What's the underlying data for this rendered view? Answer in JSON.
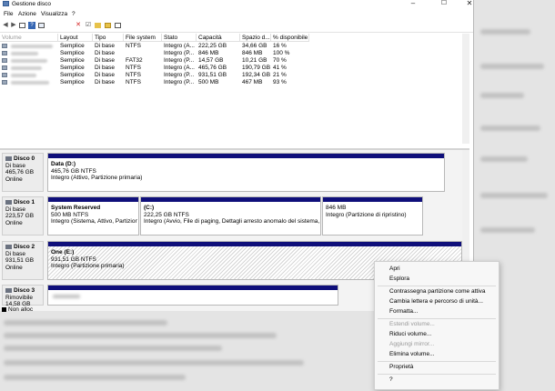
{
  "window": {
    "title": "Gestione disco"
  },
  "menu": [
    "File",
    "Azione",
    "Visualizza",
    "?"
  ],
  "volume_table": {
    "headers": [
      "Volume",
      "Layout",
      "Tipo",
      "File system",
      "Stato",
      "Capacità",
      "Spazio d...",
      "% disponibile"
    ],
    "rows": [
      [
        "Semplice",
        "Di base",
        "NTFS",
        "Integro (A...",
        "222,25 GB",
        "34,66 GB",
        "16 %"
      ],
      [
        "Semplice",
        "Di base",
        "",
        "Integro (P...",
        "846 MB",
        "846 MB",
        "100 %"
      ],
      [
        "Semplice",
        "Di base",
        "FAT32",
        "Integro (P...",
        "14,57 GB",
        "10,21 GB",
        "70 %"
      ],
      [
        "Semplice",
        "Di base",
        "NTFS",
        "Integro (A...",
        "465,76 GB",
        "190,79 GB",
        "41 %"
      ],
      [
        "Semplice",
        "Di base",
        "NTFS",
        "Integro (P...",
        "931,51 GB",
        "192,34 GB",
        "21 %"
      ],
      [
        "Semplice",
        "Di base",
        "NTFS",
        "Integro (P...",
        "500 MB",
        "467 MB",
        "93 %"
      ]
    ]
  },
  "disks": [
    {
      "name": "Disco 0",
      "type": "Di base",
      "size": "465,76 GB",
      "status": "Online",
      "partitions": [
        {
          "name": "Data  (D:)",
          "size": "465,76 GB NTFS",
          "status": "Integro (Attivo, Partizione primaria)"
        }
      ]
    },
    {
      "name": "Disco 1",
      "type": "Di base",
      "size": "223,57 GB",
      "status": "Online",
      "partitions": [
        {
          "name": "System Reserved",
          "size": "500 MB NTFS",
          "status": "Integro (Sistema, Attivo, Partizione p"
        },
        {
          "name": "(C:)",
          "size": "222,25 GB NTFS",
          "status": "Integro (Avvio, File di paging, Dettagli arresto anomalo del sistema, Partiz"
        },
        {
          "name": "",
          "size": "846 MB",
          "status": "Integro (Partizione di ripristino)"
        }
      ]
    },
    {
      "name": "Disco 2",
      "type": "Di base",
      "size": "931,51 GB",
      "status": "Online",
      "partitions": [
        {
          "name": "One  (E:)",
          "size": "931,51 GB NTFS",
          "status": "Integro (Partizione primaria)"
        }
      ]
    },
    {
      "name": "Disco 3",
      "type": "Rimovibile",
      "size": "14,58 GB",
      "status": ""
    }
  ],
  "legend": {
    "unallocated": "Non alloc"
  },
  "context_menu": {
    "items": [
      {
        "label": "Apri",
        "enabled": true
      },
      {
        "label": "Esplora",
        "enabled": true
      },
      {
        "label": "Contrassegna partizione come attiva",
        "enabled": true
      },
      {
        "label": "Cambia lettera e percorso di unità...",
        "enabled": true
      },
      {
        "label": "Formatta...",
        "enabled": true
      },
      {
        "label": "Estendi volume...",
        "enabled": false
      },
      {
        "label": "Riduci volume...",
        "enabled": true
      },
      {
        "label": "Aggiungi mirror...",
        "enabled": false
      },
      {
        "label": "Elimina volume...",
        "enabled": true
      },
      {
        "label": "Proprietà",
        "enabled": true
      },
      {
        "label": "?",
        "enabled": true
      }
    ]
  },
  "colors": {
    "partition_bar": "#0f0f7a",
    "hatch": "#d6d6d6"
  }
}
